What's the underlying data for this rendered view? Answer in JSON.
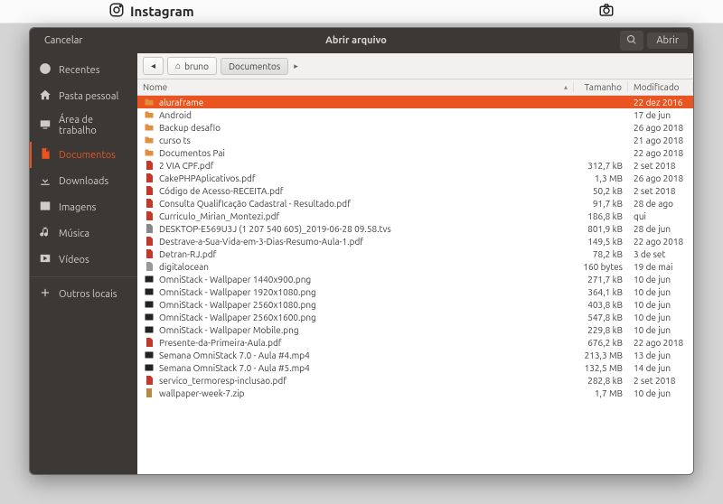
{
  "background": {
    "brand": "Instagram"
  },
  "dialog": {
    "title": "Abrir arquivo",
    "cancel": "Cancelar",
    "open": "Abrir"
  },
  "sidebar": [
    {
      "icon": "clock",
      "label": "Recentes",
      "selected": false
    },
    {
      "icon": "home",
      "label": "Pasta pessoal",
      "selected": false
    },
    {
      "icon": "desktop",
      "label": "Área de trabalho",
      "selected": false
    },
    {
      "icon": "doc",
      "label": "Documentos",
      "selected": true
    },
    {
      "icon": "down",
      "label": "Downloads",
      "selected": false
    },
    {
      "icon": "image",
      "label": "Imagens",
      "selected": false
    },
    {
      "icon": "music",
      "label": "Música",
      "selected": false
    },
    {
      "icon": "video",
      "label": "Vídeos",
      "selected": false
    },
    {
      "icon": "plus",
      "label": "Outros locais",
      "selected": false
    }
  ],
  "path": {
    "home_label": "bruno",
    "segments": [
      "Documentos"
    ]
  },
  "columns": {
    "name": "Nome",
    "size": "Tamanho",
    "modified": "Modificado"
  },
  "files": [
    {
      "type": "folder",
      "name": "aluraframe",
      "size": "",
      "modified": "22 dez 2016",
      "selected": true
    },
    {
      "type": "folder",
      "name": "Android",
      "size": "",
      "modified": "17 de jun"
    },
    {
      "type": "folder",
      "name": "Backup desafio",
      "size": "",
      "modified": "26 ago 2018"
    },
    {
      "type": "folder",
      "name": "curso ts",
      "size": "",
      "modified": "21 ago 2018"
    },
    {
      "type": "folder",
      "name": "Documentos Pai",
      "size": "",
      "modified": "22 ago 2018"
    },
    {
      "type": "pdf",
      "name": "2 VIA CPF.pdf",
      "size": "312,7 kB",
      "modified": "2 set 2018"
    },
    {
      "type": "pdf",
      "name": "CakePHPAplicativos.pdf",
      "size": "1,3 MB",
      "modified": "26 ago 2018"
    },
    {
      "type": "pdf",
      "name": "Código de Acesso-RECEITA.pdf",
      "size": "50,2 kB",
      "modified": "2 set 2018"
    },
    {
      "type": "pdf",
      "name": "Consulta Qualificação Cadastral - Resultado.pdf",
      "size": "91,7 kB",
      "modified": "28 de ago"
    },
    {
      "type": "pdf",
      "name": "Curriculo_Mirian_Montezi.pdf",
      "size": "186,8 kB",
      "modified": "qui"
    },
    {
      "type": "txt",
      "name": "DESKTOP-E569U3J (1 207 540 605)_2019-06-28 09.58.tvs",
      "size": "801,9 kB",
      "modified": "28 de jun"
    },
    {
      "type": "pdf",
      "name": "Destrave-a-Sua-Vida-em-3-Dias-Resumo-Aula-1.pdf",
      "size": "149,5 kB",
      "modified": "22 ago 2018"
    },
    {
      "type": "pdf",
      "name": "Detran-RJ.pdf",
      "size": "78,2 kB",
      "modified": "3 de set"
    },
    {
      "type": "gen",
      "name": "digitalocean",
      "size": "160 bytes",
      "modified": "19 de mai"
    },
    {
      "type": "png",
      "name": "OmniStack - Wallpaper 1440x900.png",
      "size": "271,7 kB",
      "modified": "10 de jun"
    },
    {
      "type": "png",
      "name": "OmniStack - Wallpaper 1920x1080.png",
      "size": "364,1 kB",
      "modified": "10 de jun"
    },
    {
      "type": "png",
      "name": "OmniStack - Wallpaper 2560x1080.png",
      "size": "403,8 kB",
      "modified": "10 de jun"
    },
    {
      "type": "png",
      "name": "OmniStack - Wallpaper 2560x1600.png",
      "size": "547,8 kB",
      "modified": "10 de jun"
    },
    {
      "type": "png",
      "name": "OmniStack - Wallpaper Mobile.png",
      "size": "229,8 kB",
      "modified": "10 de jun"
    },
    {
      "type": "pdf",
      "name": "Presente-da-Primeira-Aula.pdf",
      "size": "676,2 kB",
      "modified": "22 ago 2018"
    },
    {
      "type": "video",
      "name": "Semana OmniStack 7.0 - Aula #4.mp4",
      "size": "213,3 MB",
      "modified": "13 de jun"
    },
    {
      "type": "video",
      "name": "Semana OmniStack 7.0 - Aula #5.mp4",
      "size": "132,5 MB",
      "modified": "14 de jun"
    },
    {
      "type": "pdf",
      "name": "servico_termoresp-inclusao.pdf",
      "size": "282,8 kB",
      "modified": "2 set 2018"
    },
    {
      "type": "zip",
      "name": "wallpaper-week-7.zip",
      "size": "1,7 MB",
      "modified": "10 de jun"
    }
  ]
}
